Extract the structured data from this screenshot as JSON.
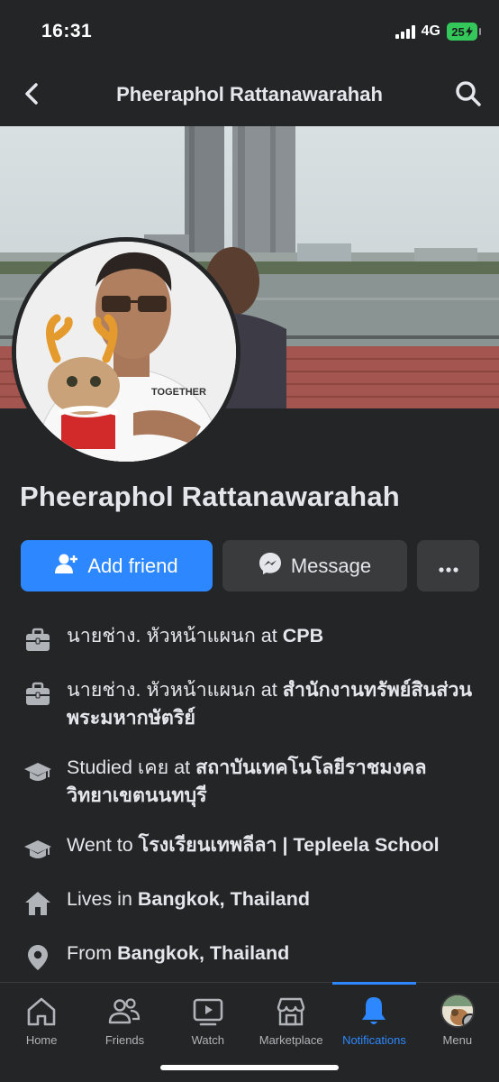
{
  "status_bar": {
    "time": "16:31",
    "network": "4G",
    "battery": "25"
  },
  "header": {
    "title": "Pheeraphol Rattanawarahah"
  },
  "profile": {
    "name": "Pheeraphol Rattanawarahah"
  },
  "actions": {
    "add_friend": "Add friend",
    "message": "Message"
  },
  "details": [
    {
      "icon": "briefcase-icon",
      "prefix": "นายช่าง. หัวหน้าแผนก at ",
      "value": "CPB"
    },
    {
      "icon": "briefcase-icon",
      "prefix": "นายช่าง. หัวหน้าแผนก at ",
      "value": "สำนักงานทรัพย์สินส่วนพระมหากษัตริย์"
    },
    {
      "icon": "graduation-cap-icon",
      "prefix": "Studied เคย at ",
      "value": "สถาบันเทคโนโลยีราชมงคลวิทยาเขตนนทบุรี"
    },
    {
      "icon": "graduation-cap-icon",
      "prefix": "Went to ",
      "value": "โรงเรียนเทพลีลา | Tepleela School"
    },
    {
      "icon": "home-icon",
      "prefix": "Lives in ",
      "value": "Bangkok, Thailand"
    },
    {
      "icon": "location-pin-icon",
      "prefix": "From ",
      "value": "Bangkok, Thailand"
    }
  ],
  "tabbar": {
    "home": "Home",
    "friends": "Friends",
    "watch": "Watch",
    "marketplace": "Marketplace",
    "notifications": "Notifications",
    "menu": "Menu",
    "active": "notifications"
  },
  "colors": {
    "accent": "#2d88ff",
    "background": "#242526",
    "button_secondary": "#3a3b3c",
    "text": "#e4e6eb"
  }
}
